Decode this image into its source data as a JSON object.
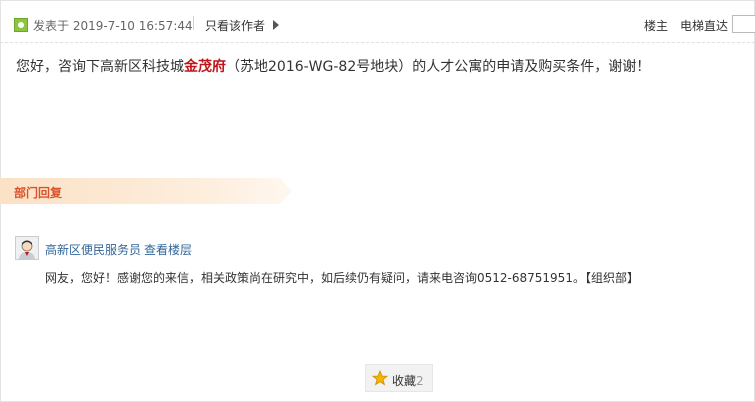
{
  "header": {
    "post_time": "发表于 2019-7-10 16:57:44",
    "only_author": "只看该作者",
    "floor_owner": "楼主",
    "elevator_jump": "电梯直达"
  },
  "question": {
    "before": "您好，咨询下高新区科技城",
    "highlight": "金茂府",
    "after": "（苏地2016-WG-82号地块）的人才公寓的申请及购买条件，谢谢！",
    "highlight_color": "#c0141b"
  },
  "department": {
    "title": "部门回复"
  },
  "reply": {
    "author": "高新区便民服务员",
    "view_floor": "查看楼层",
    "text": "网友，您好！感谢您的来信，相关政策尚在研究中，如后续仍有疑问，请来电咨询0512-68751951。【组织部】"
  },
  "favorite": {
    "label": "收藏",
    "count": "2"
  },
  "icons": {
    "online": "online-status-icon",
    "arrow": "arrow-right-icon",
    "avatar": "user-avatar-icon",
    "star": "star-icon"
  }
}
